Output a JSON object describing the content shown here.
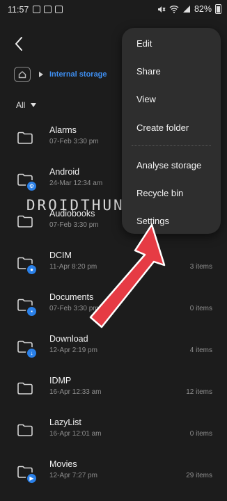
{
  "status": {
    "time": "11:57",
    "battery_pct": "82%",
    "battery_level": 0.82
  },
  "header": {
    "breadcrumb": "Internal storage",
    "filter": "All"
  },
  "menu": {
    "items": [
      "Edit",
      "Share",
      "View",
      "Create folder",
      "Analyse storage",
      "Recycle bin",
      "Settings"
    ]
  },
  "watermark": "DROIDTHUNDER.COM",
  "folders": [
    {
      "name": "Alarms",
      "date": "07-Feb 3:30 pm",
      "count": "",
      "badge": ""
    },
    {
      "name": "Android",
      "date": "24-Mar 12:34 am",
      "count": "",
      "badge": "gear-icon"
    },
    {
      "name": "Audiobooks",
      "date": "07-Feb 3:30 pm",
      "count": "",
      "badge": ""
    },
    {
      "name": "DCIM",
      "date": "11-Apr 8:20 pm",
      "count": "3 items",
      "badge": "camera-icon"
    },
    {
      "name": "Documents",
      "date": "07-Feb 3:30 pm",
      "count": "0 items",
      "badge": "document-icon"
    },
    {
      "name": "Download",
      "date": "12-Apr 2:19 pm",
      "count": "4 items",
      "badge": "download-icon"
    },
    {
      "name": "IDMP",
      "date": "16-Apr 12:33 am",
      "count": "12 items",
      "badge": ""
    },
    {
      "name": "LazyList",
      "date": "16-Apr 12:01 am",
      "count": "0 items",
      "badge": ""
    },
    {
      "name": "Movies",
      "date": "12-Apr 7:27 pm",
      "count": "29 items",
      "badge": "play-icon"
    }
  ],
  "colors": {
    "background": "#1c1c1c",
    "menu": "#2e2e2e",
    "accent": "#3e8ef0",
    "badge": "#2a80e8",
    "arrow": "#e63b44"
  }
}
